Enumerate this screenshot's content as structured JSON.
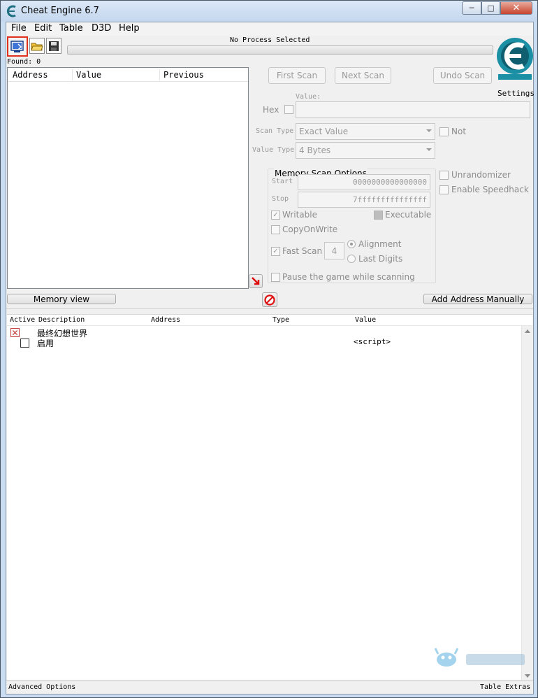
{
  "window": {
    "title": "Cheat Engine 6.7",
    "controls": {
      "minimize": "─",
      "maximize": "□",
      "close": "✕"
    }
  },
  "menu": [
    "File",
    "Edit",
    "Table",
    "D3D",
    "Help"
  ],
  "toolbar": {
    "icons": [
      "open-process-icon",
      "open-file-icon",
      "save-icon"
    ],
    "status_text": "No Process Selected",
    "found_label": "Found: 0"
  },
  "results_table": {
    "columns": [
      "Address",
      "Value",
      "Previous"
    ]
  },
  "scan": {
    "first_scan": "First Scan",
    "next_scan": "Next Scan",
    "undo_scan": "Undo Scan",
    "settings_label": "Settings",
    "value_label": "Value:",
    "hex_label": "Hex",
    "scan_type_label": "Scan Type",
    "scan_type_value": "Exact Value",
    "value_type_label": "Value Type",
    "value_type_value": "4 Bytes",
    "not_label": "Not",
    "unrandomizer_label": "Unrandomizer",
    "speedhack_label": "Enable Speedhack"
  },
  "memory_scan_options": {
    "title": "Memory Scan Options",
    "start_label": "Start",
    "start_value": "0000000000000000",
    "stop_label": "Stop",
    "stop_value": "7fffffffffffffff",
    "writable_label": "Writable",
    "executable_label": "Executable",
    "copyonwrite_label": "CopyOnWrite",
    "fastscan_label": "Fast Scan",
    "fastscan_value": "4",
    "alignment_label": "Alignment",
    "lastdigits_label": "Last Digits",
    "pause_label": "Pause the game while scanning"
  },
  "actions": {
    "memory_view": "Memory view",
    "add_address": "Add Address Manually"
  },
  "address_list": {
    "columns": [
      "Active",
      "Description",
      "Address",
      "Type",
      "Value"
    ],
    "rows": [
      {
        "description": "最终幻想世界",
        "address": "",
        "type": "",
        "value": ""
      },
      {
        "description": "启用",
        "address": "",
        "type": "",
        "value": "<script>"
      }
    ]
  },
  "footer": {
    "left": "Advanced Options",
    "right": "Table Extras"
  },
  "colors": {
    "highlight_border": "#e0301e",
    "logo_teal": "#1b8fa3",
    "titlebar": "#c9dcf2"
  }
}
